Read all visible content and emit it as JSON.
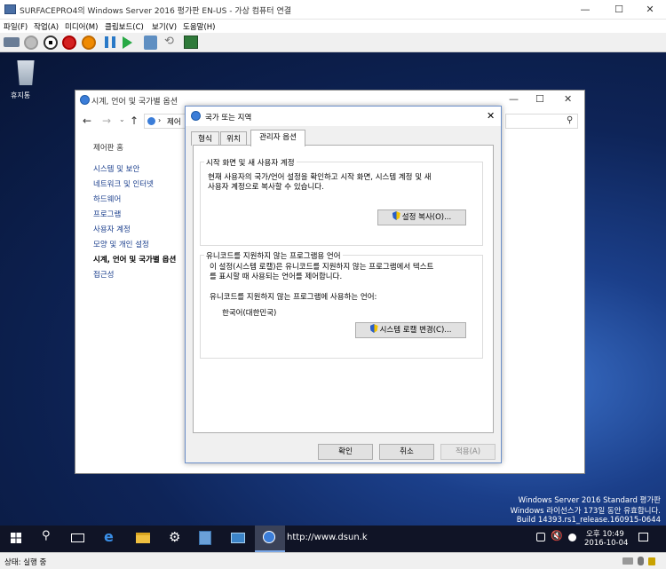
{
  "window": {
    "title": "SURFACEPRO4의 Windows Server 2016 평가판 EN-US - 가상 컴퓨터 연결",
    "minimize": "—",
    "maximize": "☐",
    "close": "✕"
  },
  "menu": [
    "파일(F)",
    "작업(A)",
    "미디어(M)",
    "클립보드(C)",
    "보기(V)",
    "도움말(H)"
  ],
  "desktop": {
    "recycle_bin": "휴지통"
  },
  "control_panel": {
    "title": "시계, 언어 및 국가별 옵션",
    "address": "제어",
    "links": [
      "제어판 홈",
      "시스템 및 보안",
      "네트워크 및 인터넷",
      "하드웨어",
      "프로그램",
      "사용자 계정",
      "모양 및 개인 설정",
      "시계, 언어 및 국가별 옵션",
      "접근성"
    ]
  },
  "dialog": {
    "title": "국가 또는 지역",
    "tabs": [
      "형식",
      "위치",
      "관리자 옵션"
    ],
    "group1": {
      "label": "시작 화면 및 새 사용자 계정",
      "text1": "현재 사용자의 국가/언어 설정을 확인하고 시작 화면, 시스템 계정 및 새",
      "text2": "사용자 계정으로 복사할 수 있습니다.",
      "button": "설정 복사(O)..."
    },
    "group2": {
      "label": "유니코드를 지원하지 않는 프로그램용 언어",
      "text1": "이 설정(시스템 로캘)은 유니코드를 지원하지 않는 프로그램에서 텍스트",
      "text2": "를 표시할 때 사용되는 언어를 제어합니다.",
      "text3": "유니코드를 지원하지 않는 프로그램에 사용하는 언어:",
      "current": "한국어(대한민국)",
      "button": "시스템 로캘 변경(C)..."
    },
    "ok": "확인",
    "cancel": "취소",
    "apply": "적용(A)"
  },
  "watermark": {
    "line1": "Windows Server 2016 Standard 평가판",
    "line2": "Windows 라이선스가 173일 동안 유효합니다.",
    "line3": "Build 14393.rs1_release.160915-0644"
  },
  "taskbar": {
    "url": "http://www.dsun.k",
    "time": "오후 10:49",
    "date": "2016-10-04"
  },
  "statusbar": {
    "status": "상태: 실행 중"
  }
}
